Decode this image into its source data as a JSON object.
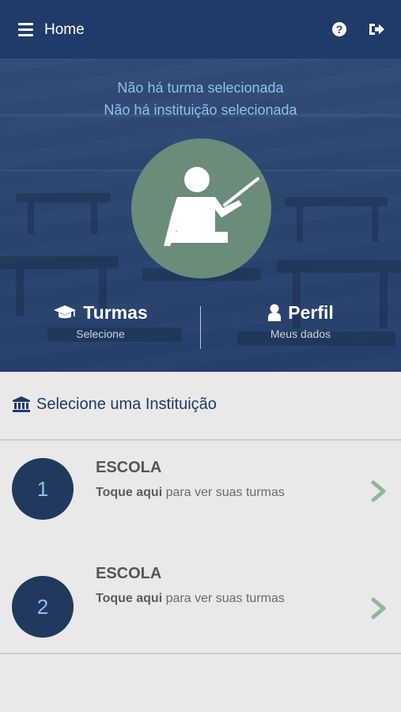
{
  "header": {
    "title": "Home"
  },
  "hero": {
    "status_turma": "Não há turma selecionada",
    "status_instituicao": "Não há instituição selecionada",
    "turmas": {
      "label": "Turmas",
      "sub": "Selecione"
    },
    "perfil": {
      "label": "Perfil",
      "sub": "Meus dados"
    }
  },
  "section": {
    "title": "Selecione uma Instituição"
  },
  "institutions": [
    {
      "number": "1",
      "name": "ESCOLA",
      "action_bold": "Toque aqui",
      "action_rest": "para ver suas turmas"
    },
    {
      "number": "2",
      "name": "ESCOLA",
      "action_bold": "Toque aqui",
      "action_rest": "para ver suas turmas"
    }
  ],
  "colors": {
    "primary": "#1f3b68",
    "accent_green": "#6c8c7a",
    "chevron_green": "#8fb89a",
    "status_text": "#8fc0ec"
  },
  "icons": [
    "menu-icon",
    "help-icon",
    "logout-icon",
    "graduation-cap-icon",
    "user-icon",
    "bank-icon",
    "teacher-icon",
    "chevron-right-icon"
  ]
}
